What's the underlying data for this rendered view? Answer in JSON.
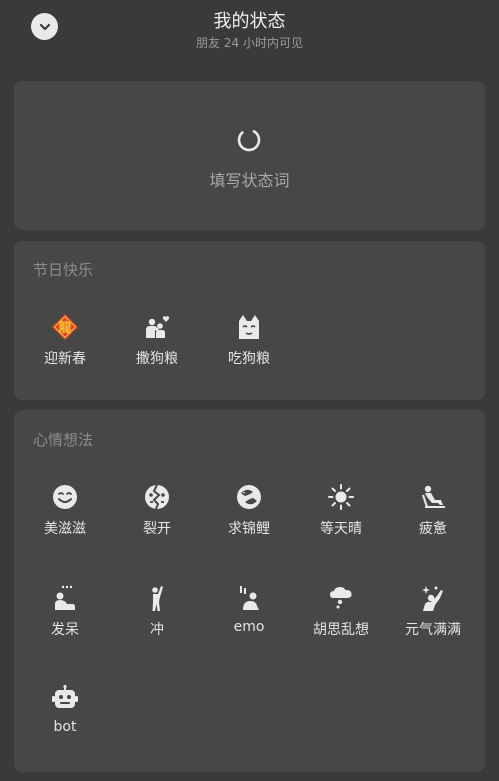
{
  "header": {
    "title": "我的状态",
    "subtitle": "朋友 24 小时内可见"
  },
  "status": {
    "input_label": "填写状态词"
  },
  "holiday": {
    "section_title": "节日快乐",
    "items": [
      {
        "label": "迎新春",
        "icon": "dragon-chunlian-icon"
      },
      {
        "label": "撒狗粮",
        "icon": "couple-heart-icon"
      },
      {
        "label": "吃狗粮",
        "icon": "cat-face-icon"
      }
    ]
  },
  "mood": {
    "section_title": "心情想法",
    "items": [
      {
        "label": "美滋滋",
        "icon": "smile-icon"
      },
      {
        "label": "裂开",
        "icon": "cracked-face-icon"
      },
      {
        "label": "求锦鲤",
        "icon": "koi-fish-icon"
      },
      {
        "label": "等天晴",
        "icon": "sun-icon"
      },
      {
        "label": "疲惫",
        "icon": "tired-person-icon"
      },
      {
        "label": "发呆",
        "icon": "daze-person-icon"
      },
      {
        "label": "冲",
        "icon": "cheer-person-icon"
      },
      {
        "label": "emo",
        "icon": "emo-person-icon"
      },
      {
        "label": "胡思乱想",
        "icon": "thought-cloud-icon"
      },
      {
        "label": "元气满满",
        "icon": "energetic-person-icon"
      },
      {
        "label": "bot",
        "icon": "robot-icon"
      }
    ]
  },
  "colors": {
    "background": "#3a3a3a",
    "card": "#474747",
    "text": "#e4e4e4",
    "muted": "#8d8d8d",
    "chunlian_red": "#e0402a",
    "chunlian_gold": "#f4c430"
  }
}
